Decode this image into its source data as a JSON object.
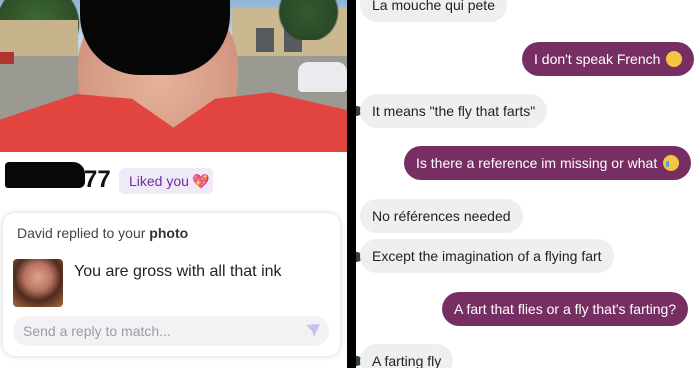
{
  "profile": {
    "age": "77",
    "liked_label": "Liked you",
    "heart_icon": "sparkling-heart-icon"
  },
  "reply_card": {
    "header_name": "David",
    "header_rest": "replied to your",
    "header_object": "photo",
    "message": "You are gross with all that ink",
    "reply_placeholder": "Send a reply to match..."
  },
  "conversation": {
    "messages": [
      {
        "side": "in",
        "text": "La mouche qui pete"
      },
      {
        "side": "out",
        "text": "I don't speak French",
        "emoji": "crying-face"
      },
      {
        "side": "in",
        "text": "It means \"the fly that farts\""
      },
      {
        "side": "out",
        "text": "Is there a reference im missing or what",
        "emoji": "loudly-crying-face"
      },
      {
        "side": "in",
        "text": "No références needed"
      },
      {
        "side": "in",
        "text": "Except the imagination of a flying fart"
      },
      {
        "side": "out",
        "text": "A fart that flies or a fly that's farting?"
      },
      {
        "side": "in",
        "text": "A farting fly"
      }
    ]
  },
  "colors": {
    "outgoing_bubble": "#772f63",
    "incoming_bubble": "#efefef",
    "liked_pill_text": "#6e2f9a"
  }
}
